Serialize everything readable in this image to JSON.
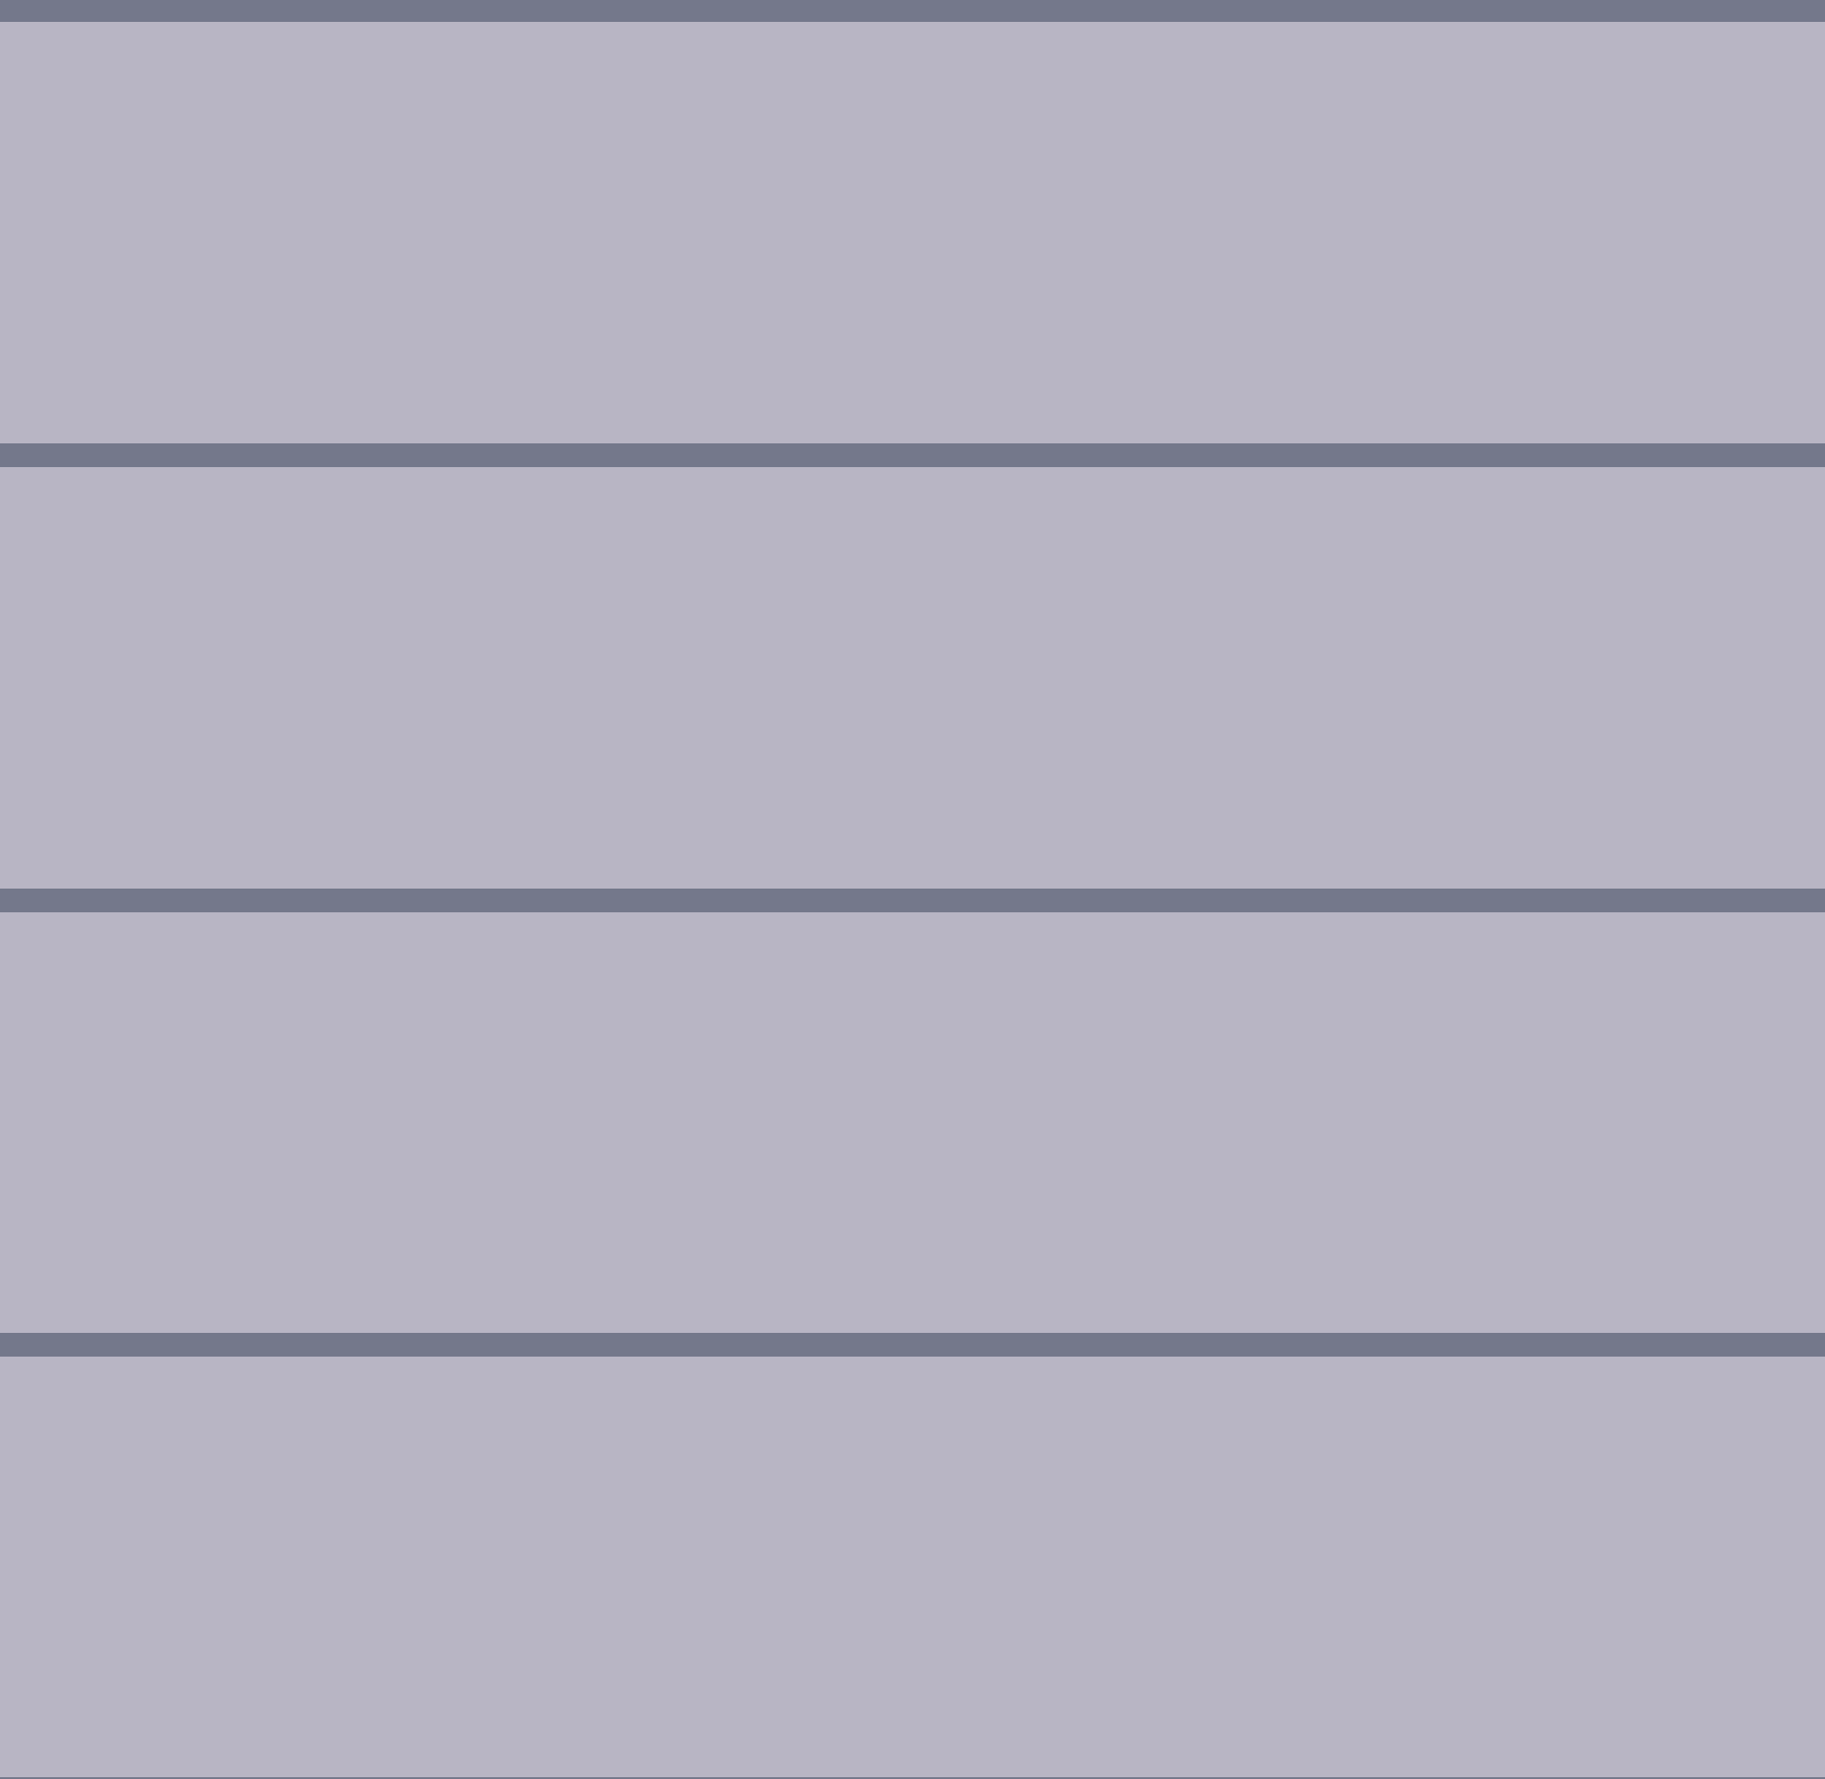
{
  "colors": {
    "panel_background": "#b8b5c4",
    "divider": "#74788b"
  },
  "panels": [
    {
      "name": "panel-1"
    },
    {
      "name": "panel-2"
    },
    {
      "name": "panel-3"
    },
    {
      "name": "panel-4"
    }
  ]
}
